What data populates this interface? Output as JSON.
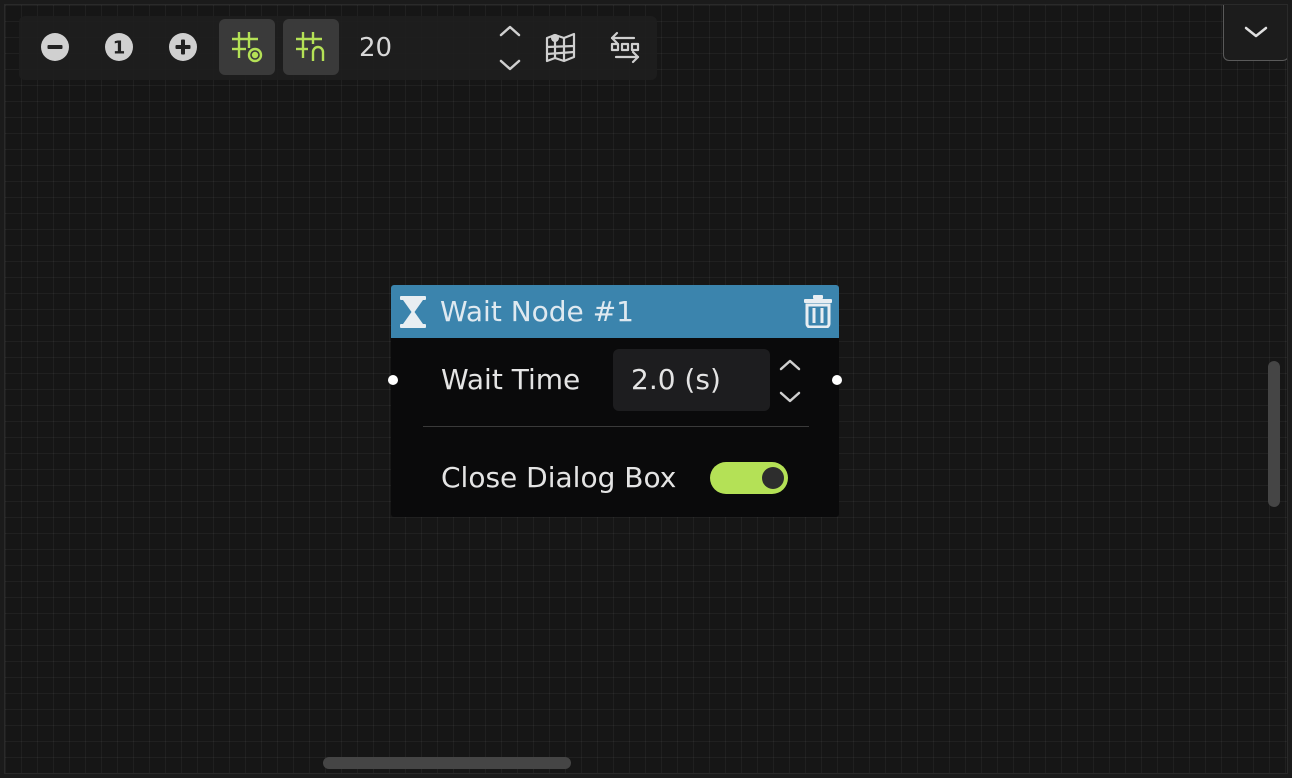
{
  "toolbar": {
    "zoom_out": {
      "icon": "minus-circle-icon"
    },
    "zoom_reset": {
      "icon": "one-circle-icon",
      "label": "1"
    },
    "zoom_in": {
      "icon": "plus-circle-icon"
    },
    "show_grid": {
      "icon": "grid-eye-icon",
      "active": true
    },
    "snap_grid": {
      "icon": "grid-magnet-icon",
      "active": true
    },
    "grid_size": "20",
    "minimap": {
      "icon": "map-icon"
    },
    "arrange": {
      "icon": "arrange-nodes-icon"
    }
  },
  "dropdown": {
    "icon": "chevron-down-icon"
  },
  "node": {
    "title": "Wait Node #1",
    "header_color": "#3b84ad",
    "icon": "hourglass-icon",
    "delete_icon": "trash-icon",
    "wait_time_label": "Wait Time",
    "wait_time_value": "2.0 (s)",
    "close_dialog_label": "Close Dialog Box",
    "close_dialog_enabled": true,
    "toggle_color": "#b4e156"
  },
  "colors": {
    "accent_green": "#b4e156",
    "header_blue": "#3b84ad",
    "background": "#161616"
  }
}
